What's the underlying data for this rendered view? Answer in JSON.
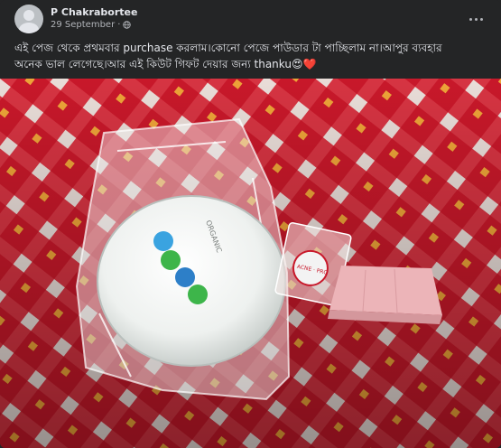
{
  "post": {
    "author": "P Chakrabortee",
    "date": "29 September",
    "separator": "·",
    "caption_line1": "এই পেজ থেকে প্রথমবার purchase করলাম।কোনো পেজে পাউডার টা পাচ্ছিলাম না।আপুর ব্যবহার",
    "caption_line2": "অনেক ভাল লেগেছে।আর এই কিউট গিফট দেয়ার জন্য thanku😍❤️",
    "privacy_icon": "globe-icon",
    "menu_icon": "more-options-icon"
  },
  "photo": {
    "compact_label": "ORGANIC",
    "sample_label": "ACNE · PRO",
    "colors": {
      "cloth_red": "#c8182a",
      "cloth_white": "#e9ddd8",
      "compact": "#eef1ef",
      "sponge": "#ecb4b8",
      "dot_blue": "#3aa3e0",
      "dot_green": "#3db54a"
    }
  }
}
